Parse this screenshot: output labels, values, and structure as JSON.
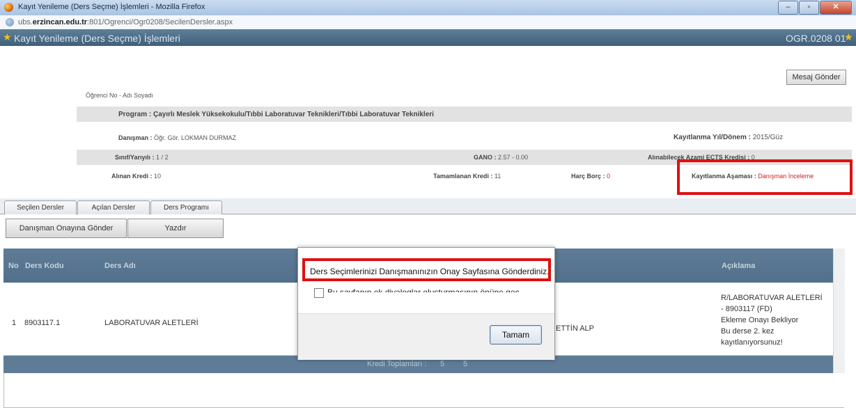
{
  "window": {
    "title": "Kayıt Yenileme (Ders Seçme) İşlemleri - Mozilla Firefox",
    "url_prefix": "ubs.",
    "url_domain": "erzincan.edu.tr",
    "url_rest": ":801/Ogrenci/Ogr0208/SecilenDersler.aspx",
    "min_glyph": "–",
    "max_glyph": "▫",
    "close_glyph": "✕"
  },
  "header": {
    "title": "Kayıt Yenileme (Ders Seçme) İşlemleri",
    "page_code": "OGR.0208 01"
  },
  "mesaj_button": "Mesaj Gönder",
  "student": {
    "ogrenci_label": "Öğrenci No - Adı Soyadı",
    "program_label": "Program :",
    "program_value": "Çayırlı Meslek Yüksekokulu/Tıbbi Laboratuvar Teknikleri/Tıbbi Laboratuvar Teknikleri",
    "danisman_label": "Danışman :",
    "danisman_value": "Öğr. Gör. LOKMAN DURMAZ",
    "kayit_yil_label": "Kayıtlanma Yıl/Dönem :",
    "kayit_yil_value": "2015/Güz",
    "sinif_label": "Sınıf/Yarıyılı :",
    "sinif_value": "1 / 2",
    "gano_label": "GANO :",
    "gano_value": "2.57 - 0.00",
    "ects_label": "Alınabilecek Azami ECTS Kredisi :",
    "ects_value": "0",
    "alinan_label": "Alınan Kredi :",
    "alinan_value": "10",
    "tamamlanan_label": "Tamamlanan Kredi :",
    "tamamlanan_value": "11",
    "harc_label": "Harç Borç :",
    "harc_value": "0",
    "asama_label": "Kayıtlanma Aşaması :",
    "asama_value": "Danışman İnceleme"
  },
  "tabs": [
    "Seçilen Dersler",
    "Açılan Dersler",
    "Ders Programı"
  ],
  "actions": {
    "send": "Danışman Onayına Gönder",
    "print": "Yazdır"
  },
  "grid": {
    "headers": {
      "no": "No",
      "kod": "Ders Kodu",
      "ad": "Ders Adı",
      "aciklama": "Açıklama"
    },
    "rows": [
      {
        "no": "1",
        "kod": "8903117.1",
        "ad": "LABORATUVAR ALETLERİ",
        "ogretim": "ETTİN ALP",
        "aciklama": [
          "R/LABORATUVAR ALETLERİ",
          "- 8903117 (FD)",
          "Ekleme Onayı Bekliyor",
          "Bu derse 2. kez",
          "kayıtlanıyorsunuz!"
        ]
      }
    ],
    "footer_label": "Kredi Toplamları :",
    "footer_values": [
      "5",
      "5"
    ]
  },
  "dialog": {
    "message": "Ders Seçimlerinizi Danışmanınızın Onay Sayfasına Gönderdiniz.",
    "checkbox_label": "Bu sayfanın ek diyaloglar oluşturmasının önüne geç",
    "ok": "Tamam"
  },
  "colors": {
    "highlight": "#e01010",
    "header_bar": "#4f6f8a",
    "star": "#f0c020"
  }
}
